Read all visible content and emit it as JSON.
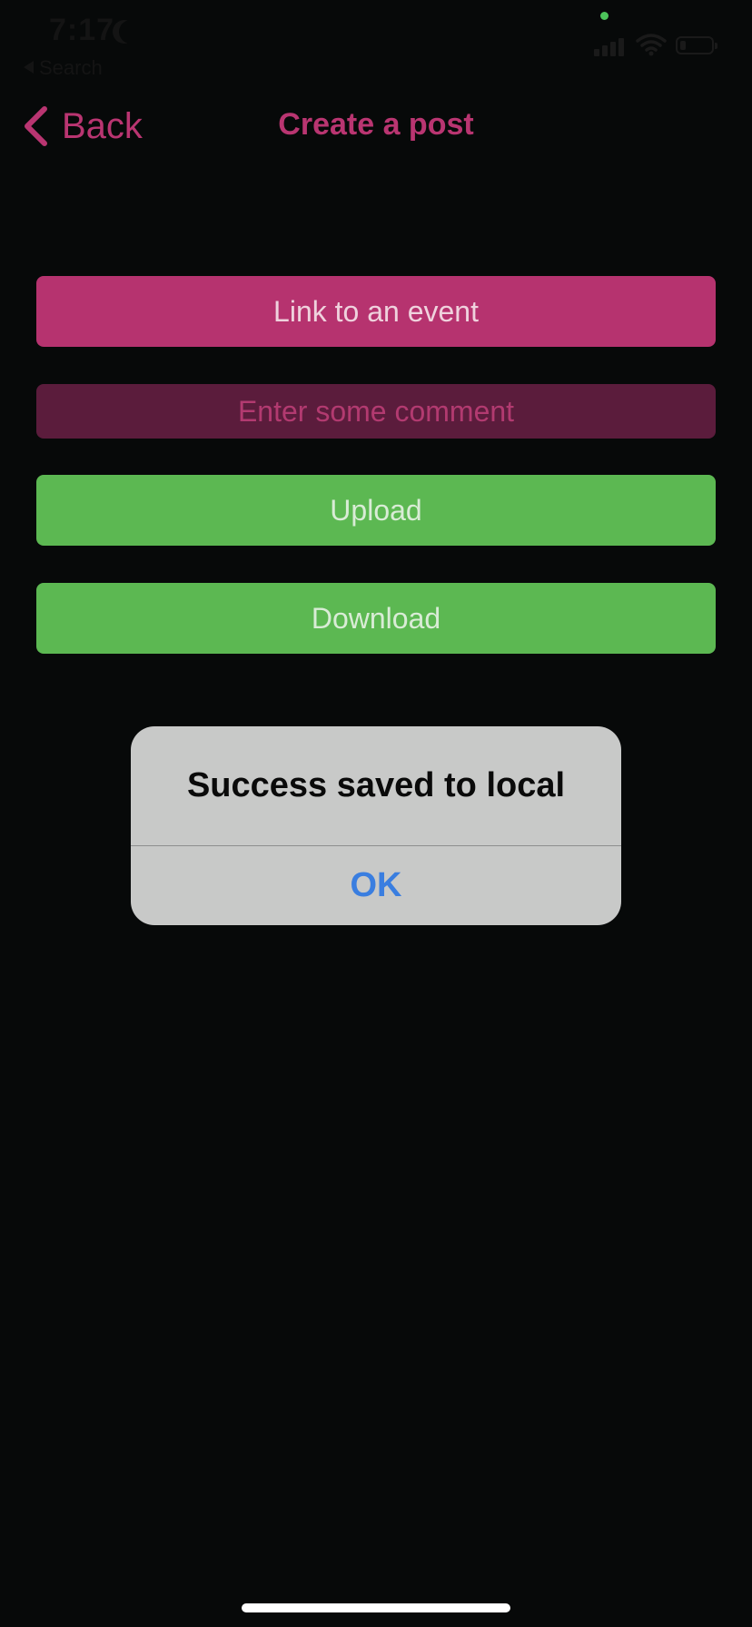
{
  "status_bar": {
    "time": "7:17",
    "back_to_app": "Search",
    "icons": [
      "moon-icon",
      "signal-icon",
      "wifi-icon",
      "battery-icon"
    ]
  },
  "nav": {
    "back_label": "Back",
    "title": "Create a post"
  },
  "form": {
    "link_event_label": "Link to an event",
    "comment_placeholder": "Enter some comment",
    "upload_label": "Upload",
    "download_label": "Download"
  },
  "alert": {
    "title": "Success saved to local",
    "ok_label": "OK"
  },
  "colors": {
    "background": "#070909",
    "accent_pink": "#b93571",
    "event_button": "#b6336f",
    "comment_field": "#5b1c3c",
    "green_button": "#5cb852",
    "alert_bg": "#c8c9c8",
    "alert_action": "#3a7ee0"
  }
}
